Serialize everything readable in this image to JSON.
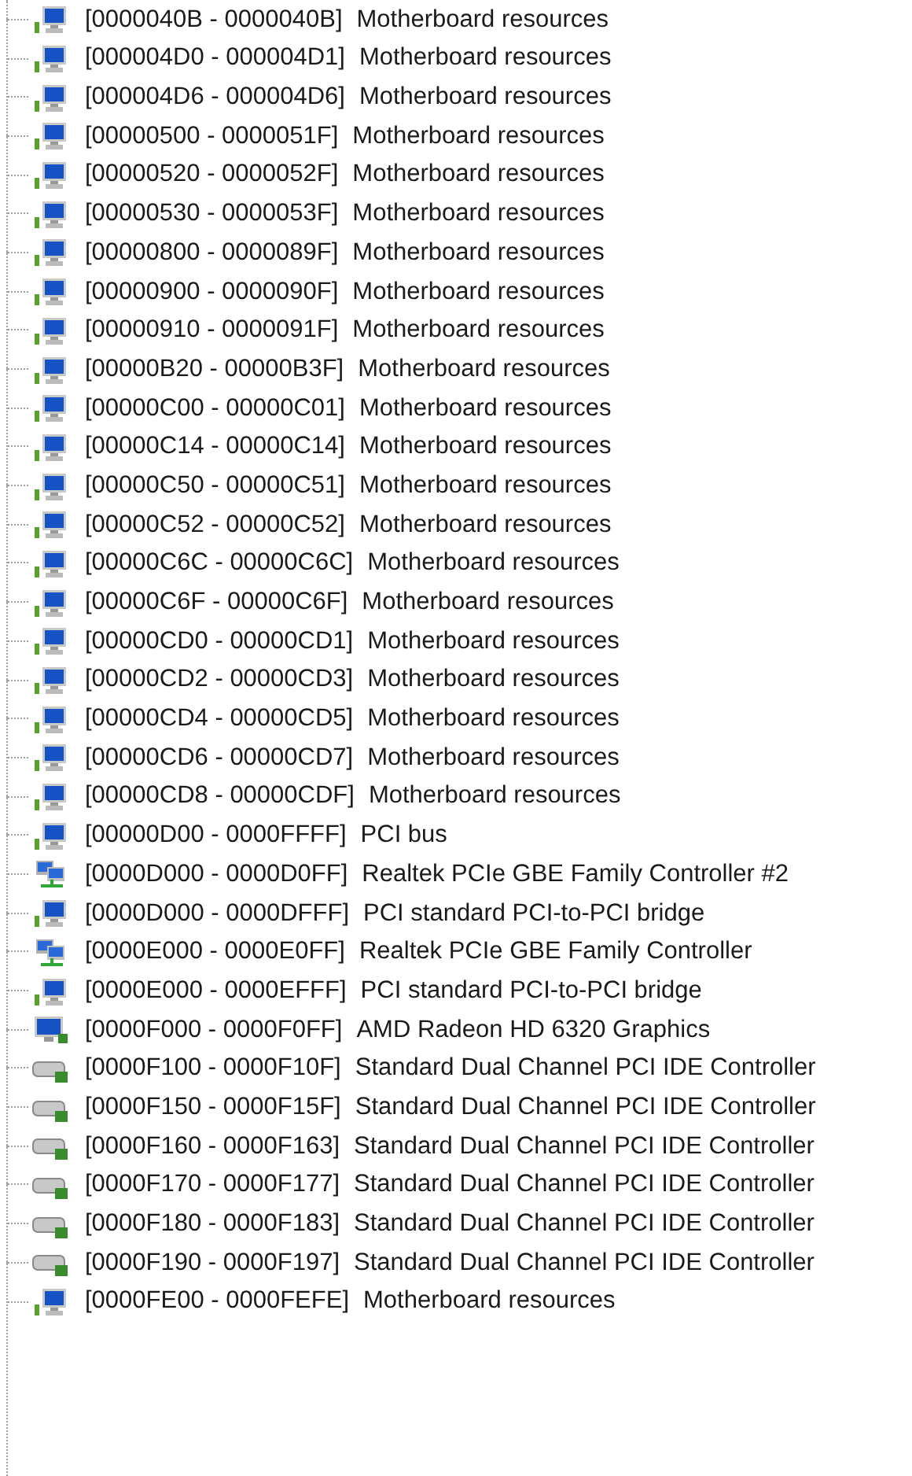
{
  "tree": {
    "items": [
      {
        "kind": "system",
        "range": "[0000040B - 0000040B]",
        "name": "Motherboard resources"
      },
      {
        "kind": "system",
        "range": "[000004D0 - 000004D1]",
        "name": "Motherboard resources"
      },
      {
        "kind": "system",
        "range": "[000004D6 - 000004D6]",
        "name": "Motherboard resources"
      },
      {
        "kind": "system",
        "range": "[00000500 - 0000051F]",
        "name": "Motherboard resources"
      },
      {
        "kind": "system",
        "range": "[00000520 - 0000052F]",
        "name": "Motherboard resources"
      },
      {
        "kind": "system",
        "range": "[00000530 - 0000053F]",
        "name": "Motherboard resources"
      },
      {
        "kind": "system",
        "range": "[00000800 - 0000089F]",
        "name": "Motherboard resources"
      },
      {
        "kind": "system",
        "range": "[00000900 - 0000090F]",
        "name": "Motherboard resources"
      },
      {
        "kind": "system",
        "range": "[00000910 - 0000091F]",
        "name": "Motherboard resources"
      },
      {
        "kind": "system",
        "range": "[00000B20 - 00000B3F]",
        "name": "Motherboard resources"
      },
      {
        "kind": "system",
        "range": "[00000C00 - 00000C01]",
        "name": "Motherboard resources"
      },
      {
        "kind": "system",
        "range": "[00000C14 - 00000C14]",
        "name": "Motherboard resources"
      },
      {
        "kind": "system",
        "range": "[00000C50 - 00000C51]",
        "name": "Motherboard resources"
      },
      {
        "kind": "system",
        "range": "[00000C52 - 00000C52]",
        "name": "Motherboard resources"
      },
      {
        "kind": "system",
        "range": "[00000C6C - 00000C6C]",
        "name": "Motherboard resources"
      },
      {
        "kind": "system",
        "range": "[00000C6F - 00000C6F]",
        "name": "Motherboard resources"
      },
      {
        "kind": "system",
        "range": "[00000CD0 - 00000CD1]",
        "name": "Motherboard resources"
      },
      {
        "kind": "system",
        "range": "[00000CD2 - 00000CD3]",
        "name": "Motherboard resources"
      },
      {
        "kind": "system",
        "range": "[00000CD4 - 00000CD5]",
        "name": "Motherboard resources"
      },
      {
        "kind": "system",
        "range": "[00000CD6 - 00000CD7]",
        "name": "Motherboard resources"
      },
      {
        "kind": "system",
        "range": "[00000CD8 - 00000CDF]",
        "name": "Motherboard resources"
      },
      {
        "kind": "system",
        "range": "[00000D00 - 0000FFFF]",
        "name": "PCI bus"
      },
      {
        "kind": "network",
        "range": "[0000D000 - 0000D0FF]",
        "name": "Realtek PCIe GBE Family Controller #2"
      },
      {
        "kind": "system",
        "range": "[0000D000 - 0000DFFF]",
        "name": "PCI standard PCI-to-PCI bridge"
      },
      {
        "kind": "network",
        "range": "[0000E000 - 0000E0FF]",
        "name": "Realtek PCIe GBE Family Controller"
      },
      {
        "kind": "system",
        "range": "[0000E000 - 0000EFFF]",
        "name": "PCI standard PCI-to-PCI bridge"
      },
      {
        "kind": "display",
        "range": "[0000F000 - 0000F0FF]",
        "name": "AMD Radeon HD 6320 Graphics"
      },
      {
        "kind": "ide",
        "range": "[0000F100 - 0000F10F]",
        "name": "Standard Dual Channel PCI IDE Controller"
      },
      {
        "kind": "ide",
        "range": "[0000F150 - 0000F15F]",
        "name": "Standard Dual Channel PCI IDE Controller"
      },
      {
        "kind": "ide",
        "range": "[0000F160 - 0000F163]",
        "name": "Standard Dual Channel PCI IDE Controller"
      },
      {
        "kind": "ide",
        "range": "[0000F170 - 0000F177]",
        "name": "Standard Dual Channel PCI IDE Controller"
      },
      {
        "kind": "ide",
        "range": "[0000F180 - 0000F183]",
        "name": "Standard Dual Channel PCI IDE Controller"
      },
      {
        "kind": "ide",
        "range": "[0000F190 - 0000F197]",
        "name": "Standard Dual Channel PCI IDE Controller"
      },
      {
        "kind": "system",
        "range": "[0000FE00 - 0000FEFE]",
        "name": "Motherboard resources"
      }
    ]
  }
}
